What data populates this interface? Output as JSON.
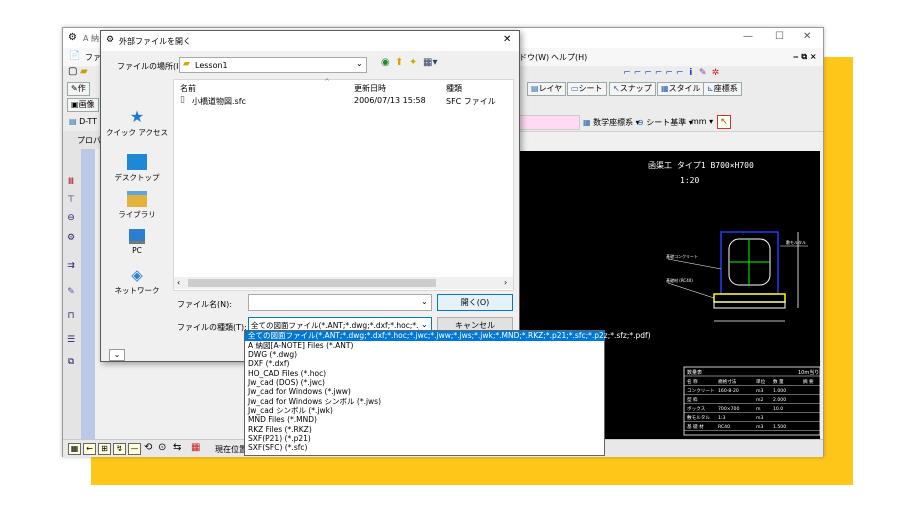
{
  "colors": {
    "accent_yellow": "#ffc61a",
    "select_blue": "#0078d7",
    "canvas": "#000000",
    "cad_line": "#ffffff",
    "cad_blue": "#1e3cff",
    "cad_green": "#00ff00",
    "cad_yellow": "#ffff00"
  },
  "app": {
    "title": "A 納",
    "win_controls": {
      "minimize": "—",
      "maximize": "☐",
      "close": "✕"
    },
    "menu_partial": "ドウ(W)",
    "menu_help": "ヘルプ(H)",
    "mdi_controls": "‒ ⧉ ×",
    "left_labels": {
      "file": "ファ",
      "draw": "作",
      "image": "画像",
      "dtt": "D-TT",
      "prop": "プロパ"
    },
    "toolbar_tabs": [
      "レイヤ",
      "シート",
      "スナップ",
      "スタイル",
      "座標系"
    ],
    "coord": {
      "system": "数学座標系",
      "sheet": "シート基準",
      "unit": "mm"
    },
    "status_label": "現在位置",
    "drawing": {
      "title": "函渠工 タイプ1 B700×H700",
      "scale": "1:20",
      "table_title": "数量表",
      "table_unit": "10m当り",
      "table_header": [
        "名 称",
        "規格寸法",
        "単位",
        "数 量",
        "摘 要"
      ],
      "table_rows": [
        [
          "コンクリート",
          "160-8-20",
          "m3",
          "1.000",
          ""
        ],
        [
          "型 枠",
          "",
          "m2",
          "2.000",
          ""
        ],
        [
          "ボックス",
          "700×700",
          "m",
          "10.0",
          ""
        ],
        [
          "敷モルタル",
          "1:3",
          "m3",
          "",
          ""
        ],
        [
          "基 礎 材",
          "RC40",
          "m3",
          "1.500",
          ""
        ]
      ],
      "annot_left": "基礎コンクリート",
      "annot_left2": "基礎材 (RC40)",
      "annot_right": "敷モルタル"
    }
  },
  "dialog": {
    "title": "外部ファイルを開く",
    "location_label": "ファイルの場所(I):",
    "location_value": "Lesson1",
    "sidebar": [
      {
        "label": "クイック アクセス",
        "icon": "star-icon"
      },
      {
        "label": "デスクトップ",
        "icon": "desktop-icon"
      },
      {
        "label": "ライブラリ",
        "icon": "library-icon"
      },
      {
        "label": "PC",
        "icon": "pc-icon"
      },
      {
        "label": "ネットワーク",
        "icon": "network-icon"
      }
    ],
    "columns": {
      "name": "名前",
      "modified": "更新日時",
      "type": "種類"
    },
    "files": [
      {
        "name": "小橋道物図.sfc",
        "modified": "2006/07/13 15:58",
        "type": "SFC ファイル"
      }
    ],
    "filename_label": "ファイル名(N):",
    "filename_value": "",
    "filetype_label": "ファイルの種類(T):",
    "filetype_value": "全ての図面ファイル(*.ANT;*.dwg;*.dxf;*.hoc;*.jwc;*.jv",
    "open_button": "開く(O)",
    "cancel_button": "キャンセル",
    "close": "✕",
    "expand": "⌄",
    "filetype_options": [
      "全ての図面ファイル(*.ANT;*.dwg;*.dxf;*.hoc;*.jwc;*.jww;*.jws;*.jwk;*.MND;*.RKZ;*.p21;*.sfc;*.p2z;*.sfz;*.pdf)",
      "A 納図[A-NOTE] Files (*.ANT)",
      "DWG (*.dwg)",
      "DXF (*.dxf)",
      "HO_CAD Files (*.hoc)",
      "Jw_cad (DOS) (*.jwc)",
      "Jw_cad for Windows (*.jww)",
      "Jw_cad for Windows シンボル (*.jws)",
      "Jw_cad シンボル (*.jwk)",
      "MND Files (*.MND)",
      "RKZ Files (*.RKZ)",
      "SXF(P21) (*.p21)",
      "SXF(SFC) (*.sfc)"
    ]
  }
}
